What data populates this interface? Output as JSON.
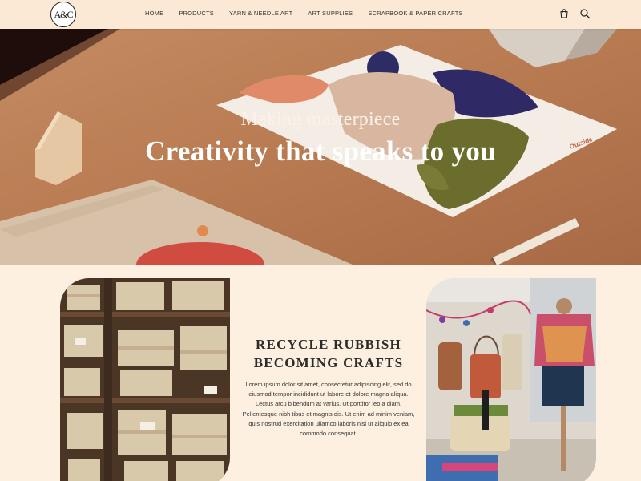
{
  "header": {
    "logo_text": "A&C",
    "nav": [
      {
        "label": "HOME"
      },
      {
        "label": "PRODUCTS"
      },
      {
        "label": "YARN & NEEDLE ART"
      },
      {
        "label": "ART SUPPLIES"
      },
      {
        "label": "SCRAPBOOK & PAPER CRAFTS"
      }
    ],
    "icons": [
      "cart-icon",
      "search-icon"
    ]
  },
  "hero": {
    "subtitle": "Making masterpiece",
    "title": "Creativity that speaks to you",
    "card_brand": "Outside"
  },
  "feature": {
    "heading_line1": "RECYCLE RUBBISH",
    "heading_line2": "BECOMING CRAFTS",
    "body": "Lorem ipsum dolor sit amet, consectetur adipiscing elit, sed do eiusmod tempor incididunt ut labore et dolore magna aliqua. Lectus arcu bibendum at varius. Ut porttitor leo a diam. Pellentesque nibh tibus et magnis dis. Ut enim ad minim veniam, quis nostrud exercitation ullamco laboris nisi ut aliquip ex ea commodo consequat."
  },
  "colors": {
    "page_bg": "#fdf0e0",
    "header_bg": "#fbe9d6",
    "hero_bg": "#b57c55"
  }
}
